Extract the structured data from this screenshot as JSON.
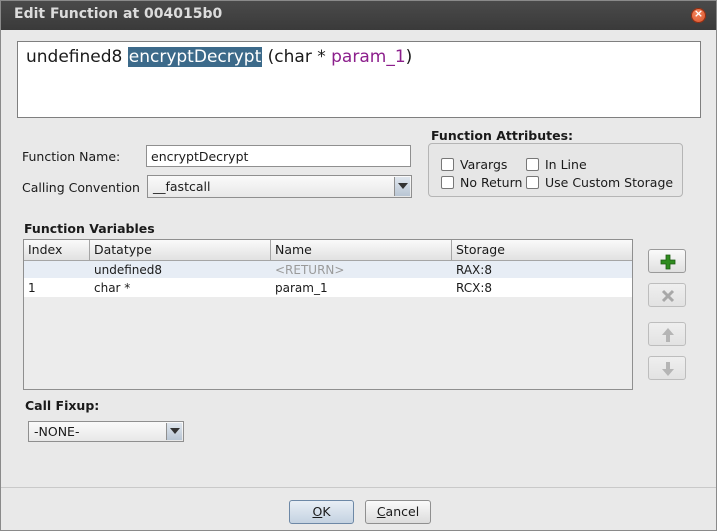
{
  "window": {
    "title": "Edit Function at 004015b0"
  },
  "signature": {
    "return_type": "undefined8",
    "name": "encryptDecrypt",
    "open": "(char * ",
    "param": "param_1",
    "close": ")"
  },
  "form": {
    "function_name_label": "Function Name:",
    "function_name_value": "encryptDecrypt",
    "calling_convention_label": "Calling Convention",
    "calling_convention_value": "__fastcall"
  },
  "attributes": {
    "title": "Function Attributes:",
    "varargs": "Varargs",
    "inline": "In Line",
    "no_return": "No Return",
    "custom_storage": "Use Custom Storage"
  },
  "variables": {
    "title": "Function Variables",
    "headers": [
      "Index",
      "Datatype",
      "Name",
      "Storage"
    ],
    "rows": [
      {
        "index": "",
        "datatype": "undefined8",
        "name": "<RETURN>",
        "storage": "RAX:8"
      },
      {
        "index": "1",
        "datatype": "char *",
        "name": "param_1",
        "storage": "RCX:8"
      }
    ]
  },
  "side_buttons": {
    "add": "add-icon",
    "remove": "remove-icon",
    "up": "arrow-up-icon",
    "down": "arrow-down-icon"
  },
  "call_fixup": {
    "label": "Call Fixup:",
    "value": "-NONE-"
  },
  "buttons": {
    "ok_first": "O",
    "ok_rest": "K",
    "cancel_first": "C",
    "cancel_rest": "ancel"
  },
  "colors": {
    "title_bar": "#3f3f3f",
    "selection": "#3c6a8a",
    "param": "#8c1f8c",
    "add_icon": "#2e8b1e"
  }
}
